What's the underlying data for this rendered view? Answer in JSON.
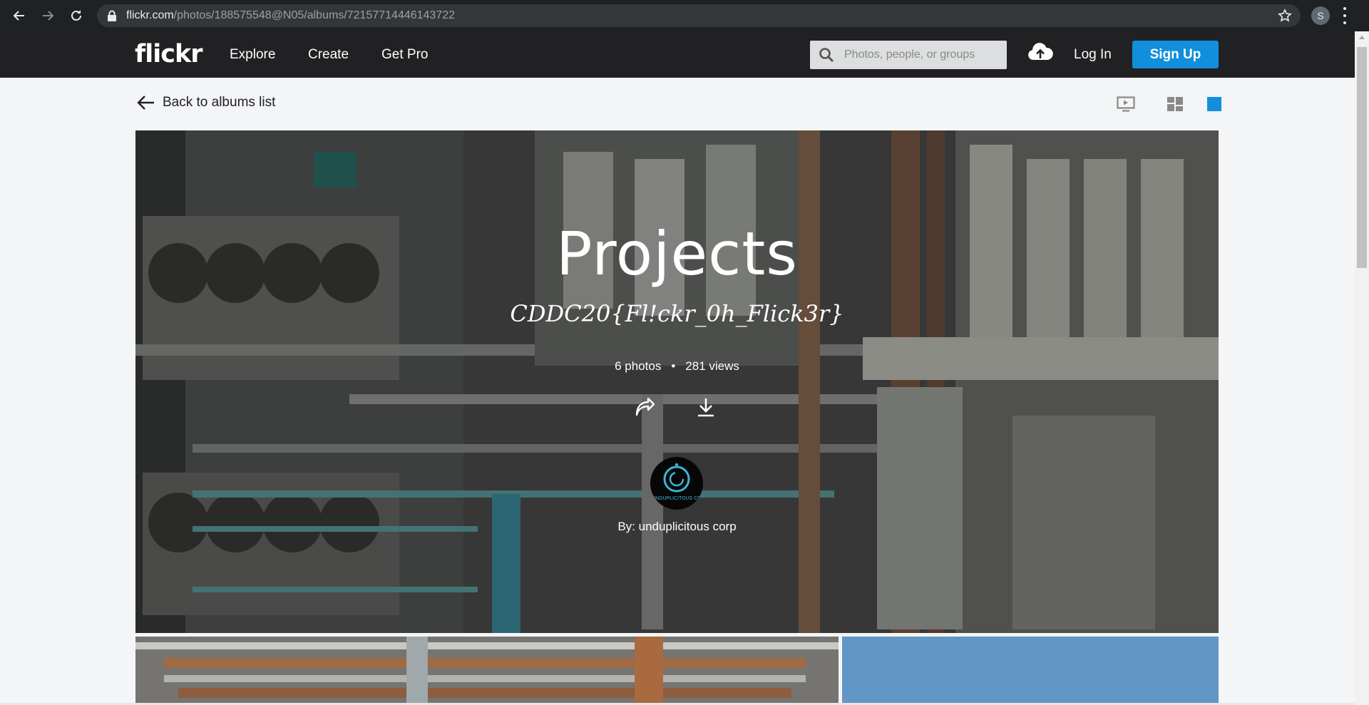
{
  "browser": {
    "url_host": "flickr.com",
    "url_path": "/photos/188575548@N05/albums/72157714446143722",
    "profile_initial": "S"
  },
  "header": {
    "logo": "flickr",
    "menu": [
      "Explore",
      "Create",
      "Get Pro"
    ],
    "search_placeholder": "Photos, people, or groups",
    "login_label": "Log In",
    "signup_label": "Sign Up"
  },
  "subbar": {
    "back_label": "Back to albums list"
  },
  "album": {
    "title": "Projects",
    "description": "CDDC20{Fl!ckr_0h_Flick3r}",
    "photos_count": "6 photos",
    "separator": "•",
    "views_count": "281 views",
    "owner": "By: unduplicitous corp",
    "avatar_text": "UNDUPLICITOUS CO"
  },
  "colors": {
    "header_bg": "#212124",
    "accent": "#128fdc",
    "page_bg": "#f3f5f6"
  }
}
